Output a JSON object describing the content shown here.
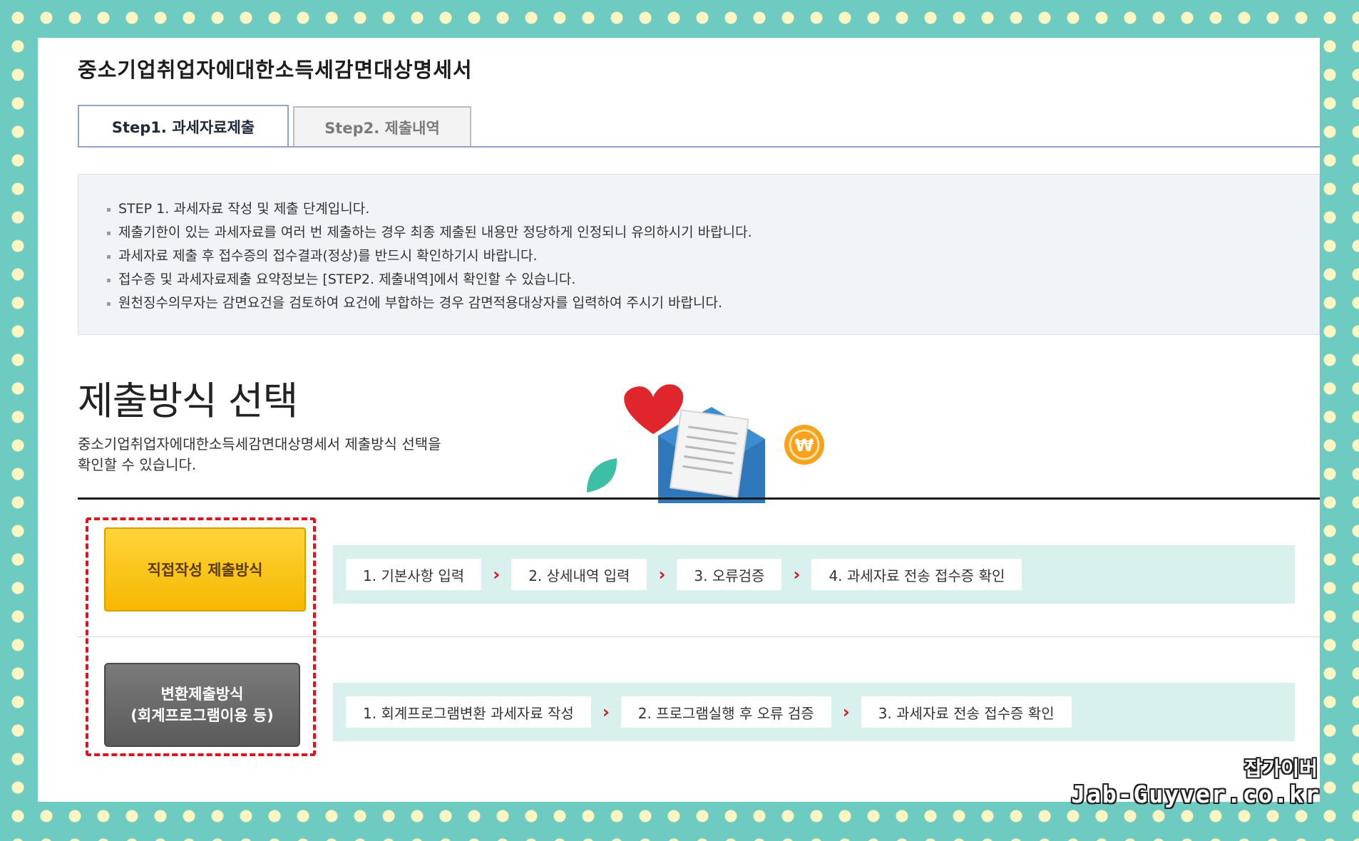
{
  "page_title": "중소기업취업자에대한소득세감면대상명세서",
  "tabs": [
    {
      "label": "Step1. 과세자료제출",
      "active": true
    },
    {
      "label": "Step2. 제출내역",
      "active": false
    }
  ],
  "notice_items": [
    "STEP 1. 과세자료 작성 및 제출 단계입니다.",
    "제출기한이 있는 과세자료를 여러 번 제출하는 경우 최종 제출된 내용만 정당하게 인정되니 유의하시기 바랍니다.",
    "과세자료 제출 후 접수증의 접수결과(정상)를 반드시 확인하기시 바랍니다.",
    "접수증 및 과세자료제출 요약정보는 [STEP2. 제출내역]에서 확인할 수 있습니다.",
    "원천징수의무자는 감면요건을 검토하여 요건에 부합하는 경우 감면적용대상자를 입력하여 주시기 바랍니다."
  ],
  "section": {
    "title": "제출방식 선택",
    "desc_line1": "중소기업취업자에대한소득세감면대상명세서 제출방식 선택을",
    "desc_line2": "확인할 수 있습니다."
  },
  "methods": {
    "direct": {
      "label": "직접작성 제출방식",
      "steps": [
        "1. 기본사항 입력",
        "2. 상세내역 입력",
        "3. 오류검증",
        "4. 과세자료 전송 접수증 확인"
      ]
    },
    "convert": {
      "label_line1": "변환제출방식",
      "label_line2": "(회계프로그램이용 등)",
      "steps": [
        "1. 회계프로그램변환 과세자료 작성",
        "2. 프로그램실행 후 오류 검증",
        "3. 과세자료 전송 접수증 확인"
      ]
    }
  },
  "arrow_glyph": "›",
  "watermark": {
    "line1": "잡가이버",
    "line2": "Jab-Guyver.co.kr"
  },
  "colors": {
    "background": "#6ecbc2",
    "dots": "#fbf6c2",
    "tab_border": "#8fa6c6",
    "notice_bg": "#f0f4f9",
    "direct_button": "#f6b800",
    "convert_button": "#5b5b5b",
    "flow_bg": "#d8f1ee",
    "arrow": "#d0141c",
    "highlight": "#e0141c"
  },
  "illustration_icons": [
    "heart-icon",
    "envelope-icon",
    "document-icon",
    "won-coin-icon",
    "leaf-icon"
  ]
}
